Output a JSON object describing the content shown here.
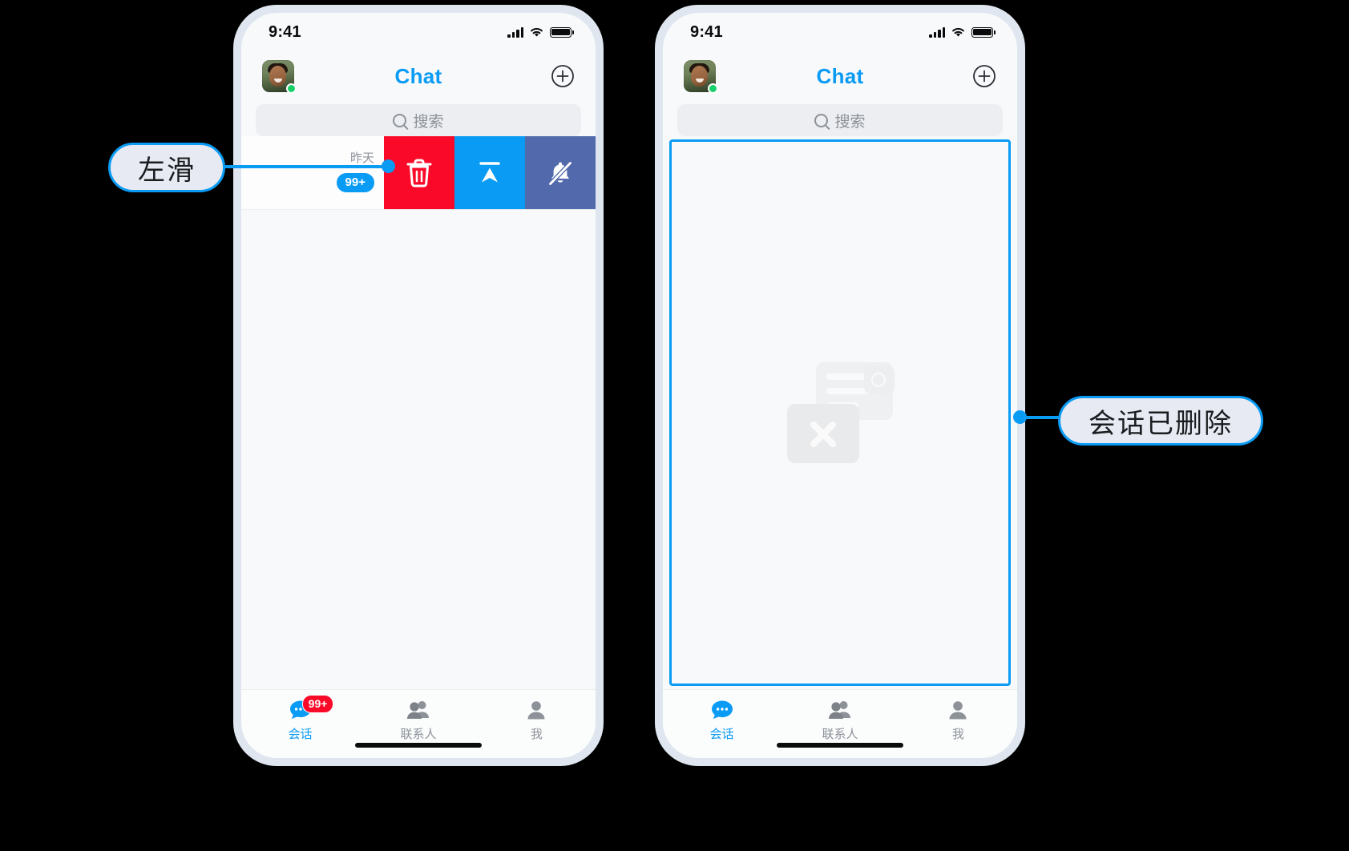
{
  "theme": {
    "accent": "#0a9bf5",
    "danger": "#fa0a28",
    "mute": "#5269ac",
    "screen_bg": "#f8f9fa",
    "bezel": "#dfe6f0",
    "muted_text": "#8d9299",
    "callout_fill": "#e7eaf2"
  },
  "phones": [
    {
      "id": "before",
      "status_bar": {
        "time": "9:41",
        "cellular_icon": "signal-bars-icon",
        "wifi_icon": "wifi-icon",
        "battery_icon": "battery-icon"
      },
      "navbar": {
        "avatar_icon": "user-avatar",
        "presence": "online",
        "title": "Chat",
        "add_icon": "plus-circle-icon"
      },
      "search": {
        "icon": "search-icon",
        "placeholder": "搜索"
      },
      "conversation_row": {
        "time": "昨天",
        "unread_badge": "99+",
        "actions": [
          {
            "key": "delete",
            "icon": "trash-icon",
            "color": "#fa0a28"
          },
          {
            "key": "pin-to-top",
            "icon": "pin-top-icon",
            "color": "#0a9bf5"
          },
          {
            "key": "mute",
            "icon": "bell-slash-icon",
            "color": "#5269ac"
          }
        ]
      },
      "tabs": [
        {
          "key": "chats",
          "label": "会话",
          "icon": "chat-bubble-icon",
          "badge": "99+",
          "active": true
        },
        {
          "key": "contacts",
          "label": "联系人",
          "icon": "contacts-icon",
          "badge": "",
          "active": false
        },
        {
          "key": "me",
          "label": "我",
          "icon": "person-icon",
          "badge": "",
          "active": false
        }
      ]
    },
    {
      "id": "after",
      "status_bar": {
        "time": "9:41",
        "cellular_icon": "signal-bars-icon",
        "wifi_icon": "wifi-icon",
        "battery_icon": "battery-icon"
      },
      "navbar": {
        "avatar_icon": "user-avatar",
        "presence": "online",
        "title": "Chat",
        "add_icon": "plus-circle-icon"
      },
      "search": {
        "icon": "search-icon",
        "placeholder": "搜索"
      },
      "empty_state": {
        "illustration": "empty-conversation-illustration"
      },
      "tabs": [
        {
          "key": "chats",
          "label": "会话",
          "icon": "chat-bubble-icon",
          "badge": "",
          "active": true
        },
        {
          "key": "contacts",
          "label": "联系人",
          "icon": "contacts-icon",
          "badge": "",
          "active": false
        },
        {
          "key": "me",
          "label": "我",
          "icon": "person-icon",
          "badge": "",
          "active": false
        }
      ]
    }
  ],
  "callouts": [
    {
      "key": "swipe-left",
      "text": "左滑"
    },
    {
      "key": "conversation-gone",
      "text": "会话已删除"
    }
  ]
}
